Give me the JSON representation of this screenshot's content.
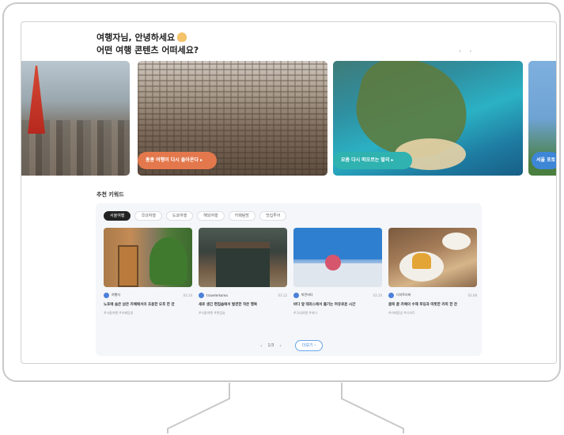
{
  "greeting": {
    "line1": "여행자님, 안녕하세요",
    "line2": "어떤 여행 콘텐츠 어떠세요?"
  },
  "hero": {
    "prev": "‹",
    "next": "›",
    "cards": [
      {
        "city": "tokyo",
        "label": ""
      },
      {
        "city": "hongkong",
        "label": "홍콩 여행이 다시 돌아온다 ▸"
      },
      {
        "city": "bali",
        "label": "요즘 다시 떠오르는 발리 ▸"
      },
      {
        "city": "seoul",
        "label": "서울 포토"
      }
    ]
  },
  "recommended": {
    "title": "추천 키워드",
    "chips": [
      "서울여행",
      "국내여행",
      "도쿄여행",
      "해외여행",
      "카페탐방",
      "맛집투어"
    ],
    "active_chip": 0,
    "cards": [
      {
        "author": "여행자",
        "date": "03.14",
        "title": "노포에 숨은 낡은 카페에서의 조용한 오후 한 잔",
        "tags": "#서울여행 #카페탐방"
      },
      {
        "author": "travelerkorea",
        "date": "03.12",
        "title": "새로 생긴 편집숍에서 발견한 작은 행복",
        "tags": "#서울여행 #편집숍"
      },
      {
        "author": "파란바다",
        "date": "03.10",
        "title": "바다 앞 테라스에서 즐기는 여유로운 시간",
        "tags": "#국내여행 #바다"
      },
      {
        "author": "디저트러버",
        "date": "03.08",
        "title": "골목 끝 카페의 수제 푸딩과 따뜻한 커피 한 잔",
        "tags": "#카페탐방 #디저트"
      }
    ],
    "pager": {
      "prev": "‹",
      "page": "1/3",
      "next": "›",
      "more": "더보기 ›"
    }
  },
  "colors": {
    "accent": "#3f86d8",
    "hk_pill": "#e3784d",
    "bali_pill": "#2fb2b0"
  },
  "icons": [
    "wave-hand-icon",
    "chevron-left-icon",
    "chevron-right-icon",
    "avatar-icon"
  ]
}
